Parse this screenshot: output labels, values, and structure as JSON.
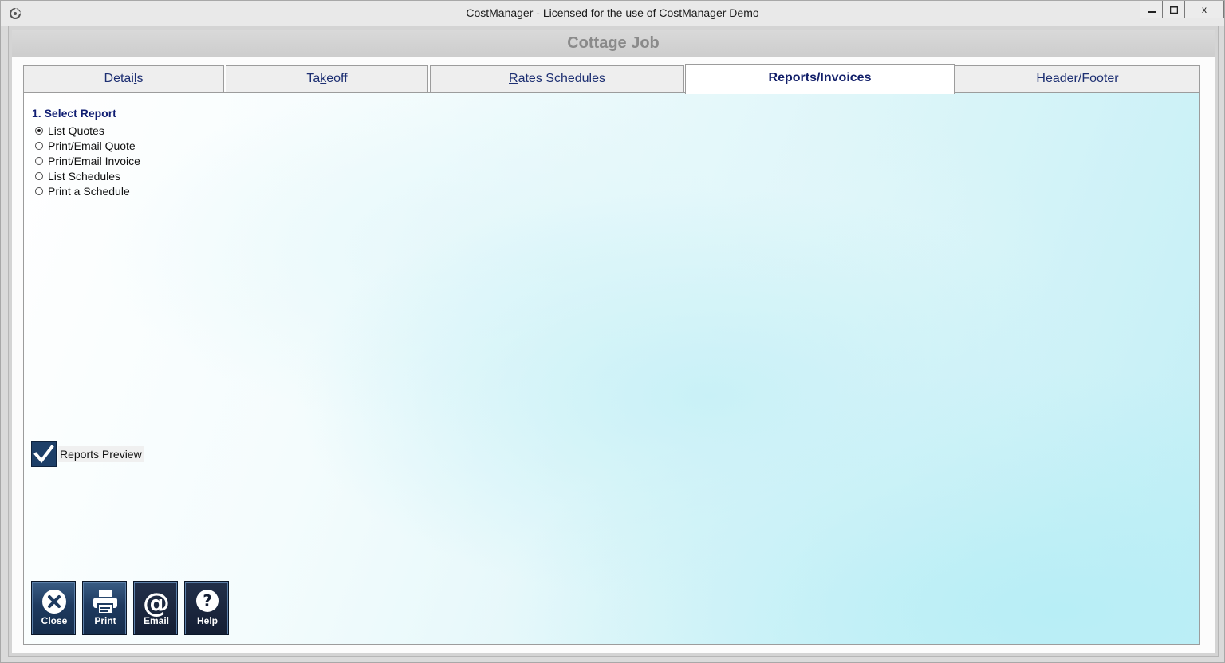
{
  "window": {
    "title": "CostManager - Licensed for the use of CostManager Demo",
    "minimize_glyph": "▁",
    "maximize_glyph": "□",
    "close_glyph": "x"
  },
  "job": {
    "title": "Cottage Job"
  },
  "tabs": [
    {
      "label_pre": "Detai",
      "label_u": "l",
      "label_post": "s"
    },
    {
      "label_pre": "Ta",
      "label_u": "k",
      "label_post": "eoff"
    },
    {
      "label_pre": "",
      "label_u": "R",
      "label_post": "ates Schedules"
    },
    {
      "label_pre": "Reports/Invoices",
      "label_u": "",
      "label_post": "",
      "active": true
    },
    {
      "label_pre": "Header/Footer",
      "label_u": "",
      "label_post": ""
    }
  ],
  "reports": {
    "section_title": "1. Select Report",
    "options": [
      {
        "label": "List Quotes",
        "selected": true
      },
      {
        "label": "Print/Email Quote",
        "selected": false
      },
      {
        "label": "Print/Email Invoice",
        "selected": false
      },
      {
        "label": "List Schedules",
        "selected": false
      },
      {
        "label": "Print a Schedule",
        "selected": false
      }
    ],
    "preview": {
      "label": "Reports Preview",
      "checked": true
    }
  },
  "buttons": [
    {
      "label": "Close",
      "icon": "close-icon"
    },
    {
      "label": "Print",
      "icon": "printer-icon"
    },
    {
      "label": "Email",
      "icon": "at-sign-icon"
    },
    {
      "label": "Help",
      "icon": "question-icon"
    }
  ],
  "colors": {
    "tab_text": "#1d2f72",
    "button_bg": "#1e3a5f",
    "section_title": "#101e73"
  }
}
